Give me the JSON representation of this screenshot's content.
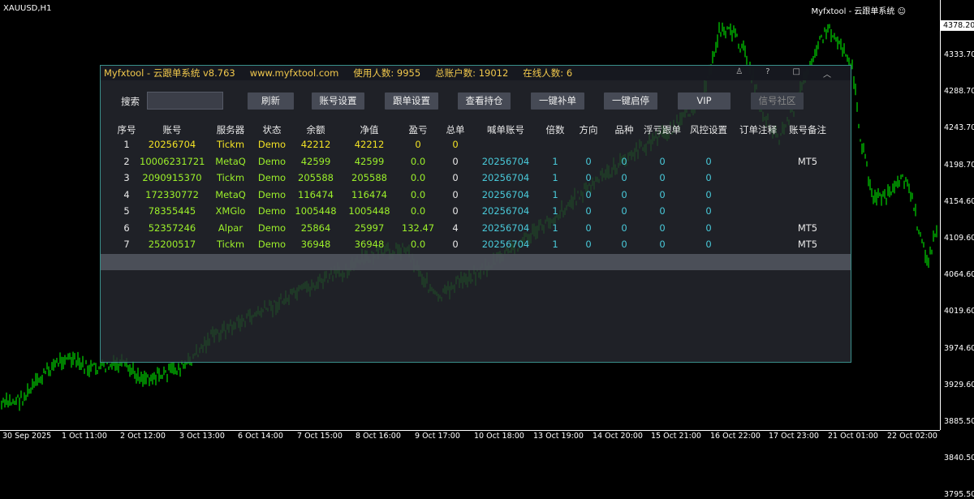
{
  "chart": {
    "symbol": "XAUUSD,H1",
    "ea_label": "Myfxtool - 云跟单系统 ☺",
    "current_price": "4378.20",
    "price_ticks": [
      "4333.70",
      "4288.70",
      "4243.70",
      "4198.70",
      "4154.60",
      "4109.60",
      "4064.60",
      "4019.60",
      "3974.60",
      "3929.60",
      "3885.50",
      "3840.50",
      "3795.50"
    ],
    "time_ticks": [
      "30 Sep 2025",
      "1 Oct 11:00",
      "2 Oct 12:00",
      "3 Oct 13:00",
      "6 Oct 14:00",
      "7 Oct 15:00",
      "8 Oct 16:00",
      "9 Oct 17:00",
      "10 Oct 18:00",
      "13 Oct 19:00",
      "14 Oct 20:00",
      "15 Oct 21:00",
      "16 Oct 22:00",
      "17 Oct 23:00",
      "21 Oct 01:00",
      "22 Oct 02:00"
    ],
    "candle_color": "#00ff00"
  },
  "panel": {
    "title": "Myfxtool - 云跟单系统  v8.763",
    "website": "www.myfxtool.com",
    "users": "使用人数: 9955",
    "accounts": "总账户数: 19012",
    "online": "在线人数: 6",
    "win_icons": [
      "user-icon",
      "help-icon",
      "maximize-icon",
      "collapse-icon"
    ],
    "search_label": "搜索",
    "search_value": "",
    "buttons": [
      "刷新",
      "账号设置",
      "跟单设置",
      "查看持仓",
      "一键补单",
      "一键启停",
      "VIP",
      "信号社区"
    ],
    "headers": [
      "序号",
      "账号",
      "服务器",
      "状态",
      "余额",
      "净值",
      "盈亏",
      "总单",
      "喊单账号",
      "倍数",
      "方向",
      "品种",
      "浮亏跟单",
      "风控设置",
      "订单注释",
      "账号备注"
    ],
    "rows": [
      [
        "1",
        "20256704",
        "Tickm",
        "Demo",
        "42212",
        "42212",
        "0",
        "0",
        "",
        "",
        "",
        "",
        "",
        "",
        "",
        ""
      ],
      [
        "2",
        "10006231721",
        "MetaQ",
        "Demo",
        "42599",
        "42599",
        "0.0",
        "0",
        "20256704",
        "1",
        "0",
        "0",
        "0",
        "0",
        "",
        "MT5"
      ],
      [
        "3",
        "2090915370",
        "Tickm",
        "Demo",
        "205588",
        "205588",
        "0.0",
        "0",
        "20256704",
        "1",
        "0",
        "0",
        "0",
        "0",
        "",
        ""
      ],
      [
        "4",
        "172330772",
        "MetaQ",
        "Demo",
        "116474",
        "116474",
        "0.0",
        "0",
        "20256704",
        "1",
        "0",
        "0",
        "0",
        "0",
        "",
        ""
      ],
      [
        "5",
        "78355445",
        "XMGlo",
        "Demo",
        "1005448",
        "1005448",
        "0.0",
        "0",
        "20256704",
        "1",
        "0",
        "0",
        "0",
        "0",
        "",
        ""
      ],
      [
        "6",
        "52357246",
        "Alpar",
        "Demo",
        "25864",
        "25997",
        "132.47",
        "4",
        "20256704",
        "1",
        "0",
        "0",
        "0",
        "0",
        "",
        "MT5"
      ],
      [
        "7",
        "25200517",
        "Tickm",
        "Demo",
        "36948",
        "36948",
        "0.0",
        "0",
        "20256704",
        "1",
        "0",
        "0",
        "0",
        "0",
        "",
        "MT5"
      ]
    ]
  }
}
